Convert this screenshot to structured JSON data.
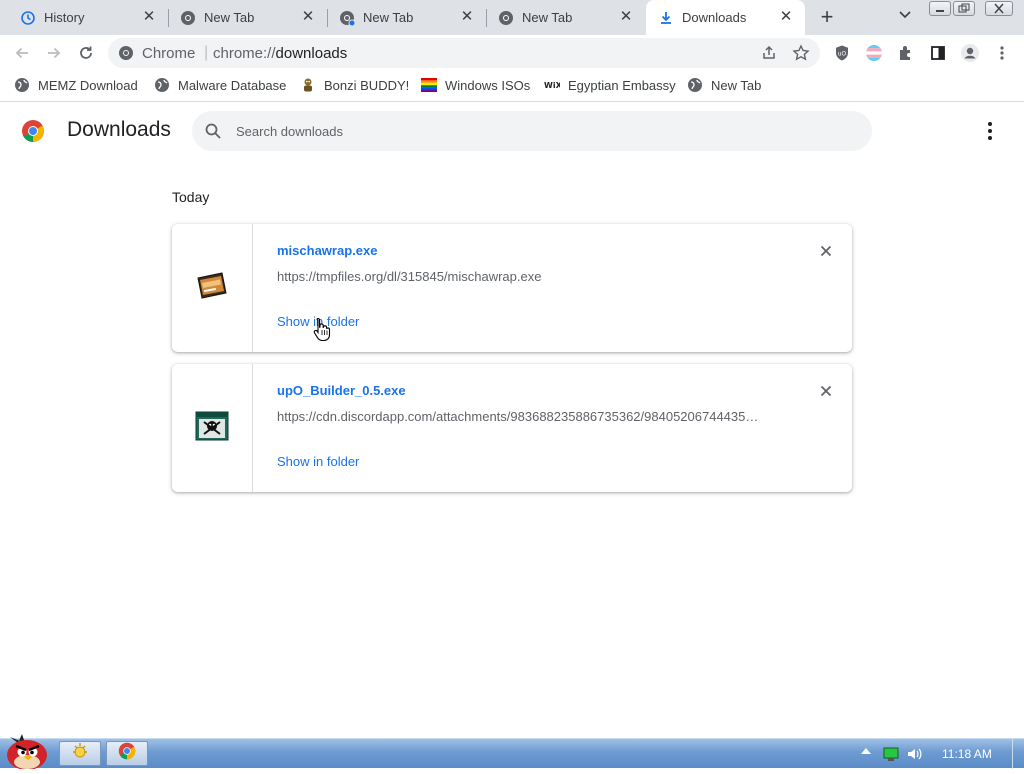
{
  "tabs": [
    {
      "title": "History",
      "icon": "history-icon",
      "active": false
    },
    {
      "title": "New Tab",
      "icon": "chrome-icon",
      "active": false
    },
    {
      "title": "New Tab",
      "icon": "chrome-icon",
      "active": false
    },
    {
      "title": "New Tab",
      "icon": "chrome-icon",
      "active": false
    },
    {
      "title": "Downloads",
      "icon": "download-icon",
      "active": true
    }
  ],
  "toolbar": {
    "site_label": "Chrome",
    "url_scheme": "chrome://",
    "url_path": "downloads"
  },
  "bookmarks": [
    {
      "label": "MEMZ Download",
      "icon": "globe-icon"
    },
    {
      "label": "Malware Database",
      "icon": "globe-icon"
    },
    {
      "label": "Bonzi BUDDY!",
      "icon": "bonzi-icon"
    },
    {
      "label": "Windows ISOs",
      "icon": "rainbow-flag-icon"
    },
    {
      "label": "Egyptian Embassy",
      "icon": "wix-icon"
    },
    {
      "label": "New Tab",
      "icon": "globe-icon"
    }
  ],
  "downloads_page": {
    "title": "Downloads",
    "search_placeholder": "Search downloads",
    "section_label": "Today",
    "items": [
      {
        "file_name": "mischawrap.exe",
        "url": "https://tmpfiles.org/dl/315845/mischawrap.exe",
        "action_label": "Show in folder",
        "icon": "exe-file-icon"
      },
      {
        "file_name": "upO_Builder_0.5.exe",
        "url": "https://cdn.discordapp.com/attachments/983688235886735362/98405206744435…",
        "action_label": "Show in folder",
        "icon": "skull-exe-icon"
      }
    ]
  },
  "taskbar": {
    "clock": "11:18 AM"
  },
  "colors": {
    "accent": "#1a73e8",
    "tabstrip": "#dee1e6",
    "omnibox": "#f1f3f4"
  }
}
